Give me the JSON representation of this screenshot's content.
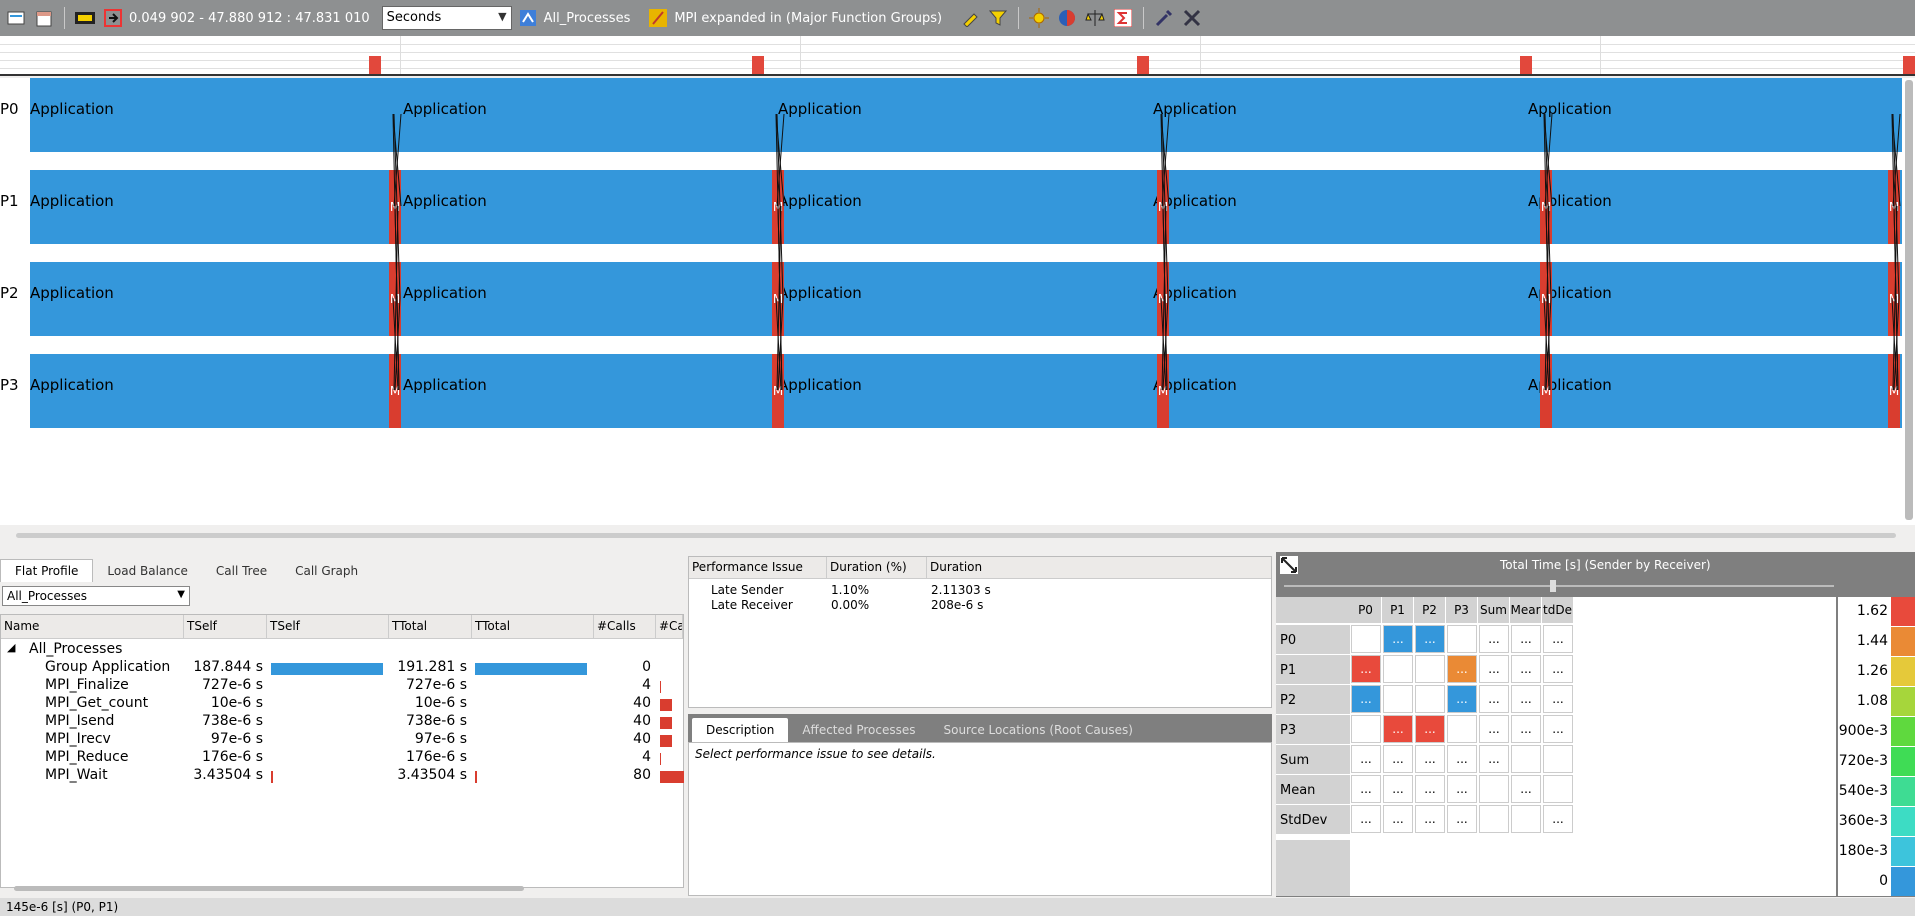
{
  "toolbar": {
    "time_range": "0.049 902 - 47.880 912 : 47.831 010",
    "units_select": "Seconds",
    "process_group": "All_Processes",
    "function_grouping": "MPI expanded in (Major Function Groups)"
  },
  "timeline": {
    "processes": [
      "P0",
      "P1",
      "P2",
      "P3"
    ],
    "segment_label": "Application",
    "mpi_label": "M"
  },
  "colors": {
    "application": "#3497db",
    "mpi": "#d93d2f",
    "toolbar": "#8e9091"
  },
  "bottom_tabs": [
    "Flat Profile",
    "Load Balance",
    "Call Tree",
    "Call Graph"
  ],
  "flat_profile": {
    "process_select": "All_Processes",
    "columns": [
      "Name",
      "TSelf",
      "TSelf",
      "TTotal",
      "TTotal",
      "#Calls",
      "#Ca"
    ],
    "root": "All_Processes",
    "rows": [
      {
        "name": "Group Application",
        "tself": "187.844 s",
        "ttotal": "191.281 s",
        "calls": "0",
        "tself_frac": 0.98,
        "ttotal_frac": 0.98,
        "calls_frac": 0
      },
      {
        "name": "MPI_Finalize",
        "tself": "727e-6 s",
        "ttotal": "727e-6 s",
        "calls": "4",
        "tself_frac": 0,
        "ttotal_frac": 0,
        "calls_frac": 0.05
      },
      {
        "name": "MPI_Get_count",
        "tself": "10e-6 s",
        "ttotal": "10e-6 s",
        "calls": "40",
        "tself_frac": 0,
        "ttotal_frac": 0,
        "calls_frac": 0.5
      },
      {
        "name": "MPI_Isend",
        "tself": "738e-6 s",
        "ttotal": "738e-6 s",
        "calls": "40",
        "tself_frac": 0,
        "ttotal_frac": 0,
        "calls_frac": 0.5
      },
      {
        "name": "MPI_Irecv",
        "tself": "97e-6 s",
        "ttotal": "97e-6 s",
        "calls": "40",
        "tself_frac": 0,
        "ttotal_frac": 0,
        "calls_frac": 0.5
      },
      {
        "name": "MPI_Reduce",
        "tself": "176e-6 s",
        "ttotal": "176e-6 s",
        "calls": "4",
        "tself_frac": 0,
        "ttotal_frac": 0,
        "calls_frac": 0.05
      },
      {
        "name": "MPI_Wait",
        "tself": "3.43504 s",
        "ttotal": "3.43504 s",
        "calls": "80",
        "tself_frac": 0.02,
        "ttotal_frac": 0.02,
        "calls_frac": 1.0
      }
    ]
  },
  "performance": {
    "columns": [
      "Performance Issue",
      "Duration (%)",
      "Duration"
    ],
    "rows": [
      {
        "issue": "Late Sender",
        "pct": "1.10%",
        "duration": "2.11303 s"
      },
      {
        "issue": "Late Receiver",
        "pct": "0.00%",
        "duration": "208e-6 s"
      }
    ]
  },
  "description": {
    "tabs": [
      "Description",
      "Affected Processes",
      "Source Locations (Root Causes)"
    ],
    "text": "Select performance issue to see details."
  },
  "matrix": {
    "title": "Total Time [s] (Sender by Receiver)",
    "col_headers": [
      "P0",
      "P1",
      "P2",
      "P3",
      "Sum",
      "Mean",
      "StdDev"
    ],
    "col_headers_display": [
      "P0",
      "P1",
      "P2",
      "P3",
      "Sum",
      "Mear",
      "tdDe"
    ],
    "row_headers": [
      "P0",
      "P1",
      "P2",
      "P3",
      "Sum",
      "Mean",
      "StdDev"
    ],
    "cell_text": "...",
    "cells": [
      [
        "",
        "blue",
        "blue",
        "",
        "t",
        "t",
        "t"
      ],
      [
        "red",
        "",
        "",
        "orange",
        "t",
        "t",
        "t"
      ],
      [
        "blue",
        "",
        "",
        "blue",
        "t",
        "t",
        "t"
      ],
      [
        "",
        "red",
        "red",
        "",
        "t",
        "t",
        "t"
      ],
      [
        "t",
        "t",
        "t",
        "t",
        "t",
        "",
        ""
      ],
      [
        "t",
        "t",
        "t",
        "t",
        "",
        "t",
        ""
      ],
      [
        "t",
        "t",
        "t",
        "t",
        "",
        "",
        "t"
      ]
    ]
  },
  "legend": [
    {
      "value": "1.62",
      "color": "#e84a3c"
    },
    {
      "value": "1.44",
      "color": "#ea8a35"
    },
    {
      "value": "1.26",
      "color": "#e5c93a"
    },
    {
      "value": "1.08",
      "color": "#a6d63b"
    },
    {
      "value": "900e-3",
      "color": "#5fd93e"
    },
    {
      "value": "720e-3",
      "color": "#3fdc55"
    },
    {
      "value": "540e-3",
      "color": "#3edc93"
    },
    {
      "value": "360e-3",
      "color": "#3ddcc4"
    },
    {
      "value": "180e-3",
      "color": "#3dc4dc"
    },
    {
      "value": "0",
      "color": "#3497db"
    }
  ],
  "status": "145e-6 [s] (P0, P1)"
}
